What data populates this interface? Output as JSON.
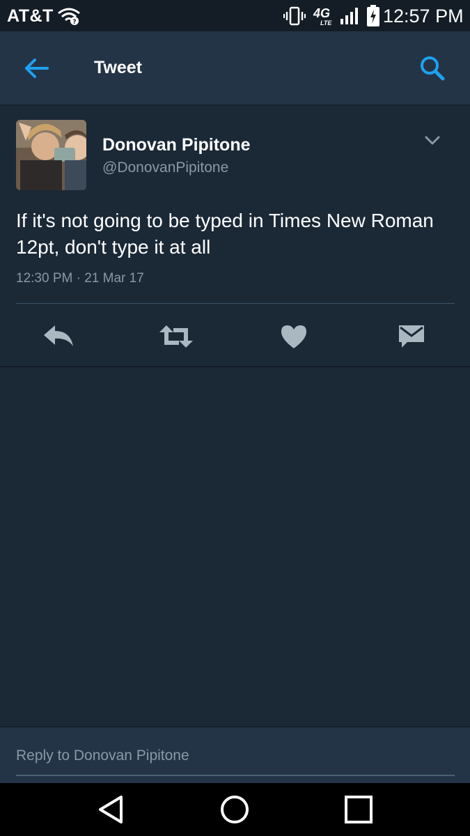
{
  "status_bar": {
    "carrier": "AT&T",
    "network_big": "4G",
    "network_small": "LTE",
    "time": "12:57 PM",
    "icons": [
      "wifi-icon",
      "vibrate-icon",
      "signal-icon",
      "battery-charging-icon"
    ]
  },
  "header": {
    "title": "Tweet",
    "back_icon": "arrow-left-icon",
    "search_icon": "search-icon"
  },
  "tweet": {
    "author_name": "Donovan Pipitone",
    "author_handle": "@DonovanPipitone",
    "text": "If it's not going to be typed in Times New Roman 12pt, don't type it at all",
    "meta": "12:30 PM · 21 Mar 17",
    "actions": [
      "reply-icon",
      "retweet-icon",
      "heart-icon",
      "envelope-icon"
    ]
  },
  "reply_bar": {
    "placeholder": "Reply to Donovan Pipitone"
  },
  "nav_bar": {
    "icons": [
      "back-triangle-icon",
      "home-circle-icon",
      "recent-square-icon"
    ]
  },
  "colors": {
    "background": "#1b2836",
    "header": "#243447",
    "status_bar": "#141d26",
    "accent": "#1da1f2",
    "secondary_text": "#8899a6",
    "action_icon": "#aab8c2"
  }
}
